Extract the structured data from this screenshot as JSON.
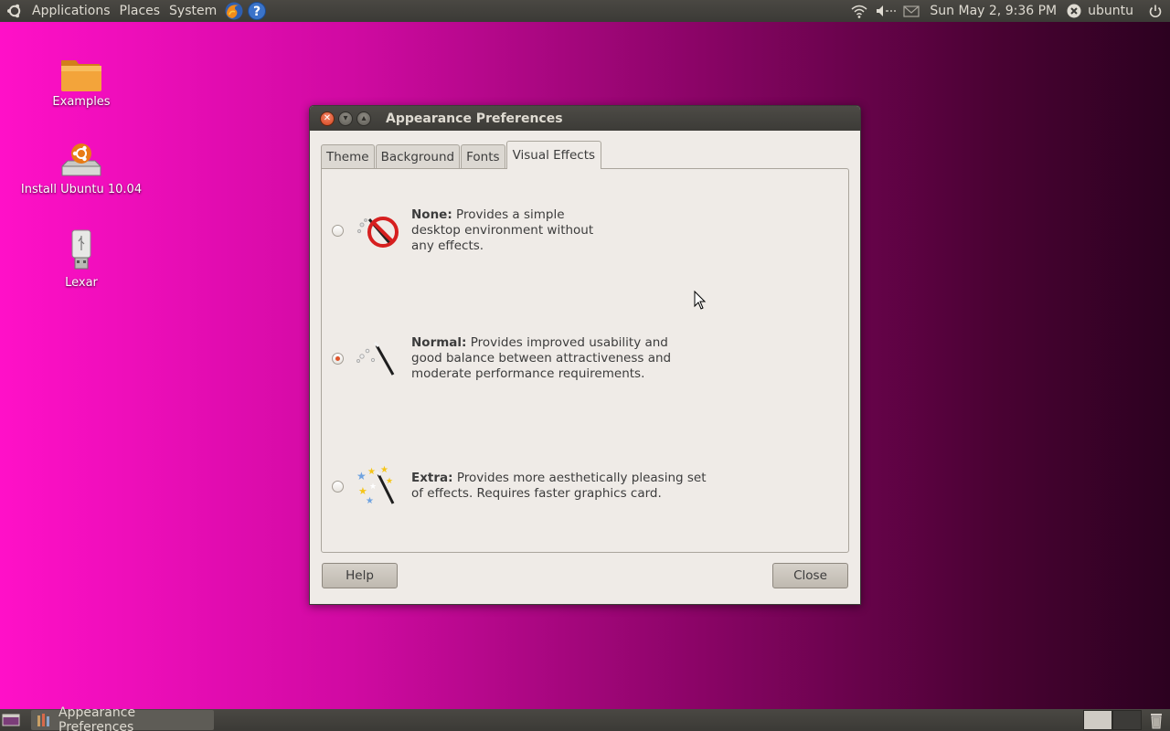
{
  "top_panel": {
    "menus": [
      "Applications",
      "Places",
      "System"
    ],
    "clock": "Sun May  2,  9:36 PM",
    "user": "ubuntu",
    "icons": [
      "ubuntu-logo-icon",
      "firefox-icon",
      "help-icon",
      "wifi-icon",
      "volume-icon",
      "mail-icon",
      "session-icon",
      "power-icon"
    ]
  },
  "desktop_icons": [
    {
      "label": "Examples",
      "icon": "folder-icon"
    },
    {
      "label": "Install Ubuntu 10.04",
      "icon": "installer-icon"
    },
    {
      "label": "Lexar",
      "icon": "usb-drive-icon"
    }
  ],
  "window": {
    "title": "Appearance Preferences",
    "tabs": [
      "Theme",
      "Background",
      "Fonts",
      "Visual Effects"
    ],
    "active_tab": "Visual Effects",
    "options": [
      {
        "name": "None:",
        "desc_lines": [
          " Provides a simple",
          "desktop environment without",
          "any effects."
        ],
        "checked": false
      },
      {
        "name": "Normal:",
        "desc_lines": [
          " Provides improved usability and",
          "good balance between attractiveness and",
          "moderate performance requirements."
        ],
        "checked": true
      },
      {
        "name": "Extra:",
        "desc_lines": [
          " Provides more aesthetically pleasing set",
          "of effects. Requires faster graphics card."
        ],
        "checked": false
      }
    ],
    "buttons": {
      "help": "Help",
      "close": "Close"
    }
  },
  "bottom_panel": {
    "task_label": "Appearance Preferences",
    "workspaces": 2,
    "active_workspace": 1
  },
  "colors": {
    "panel": "#3c3b37",
    "accent": "#e0542a",
    "dialog_bg": "#efebe7"
  }
}
